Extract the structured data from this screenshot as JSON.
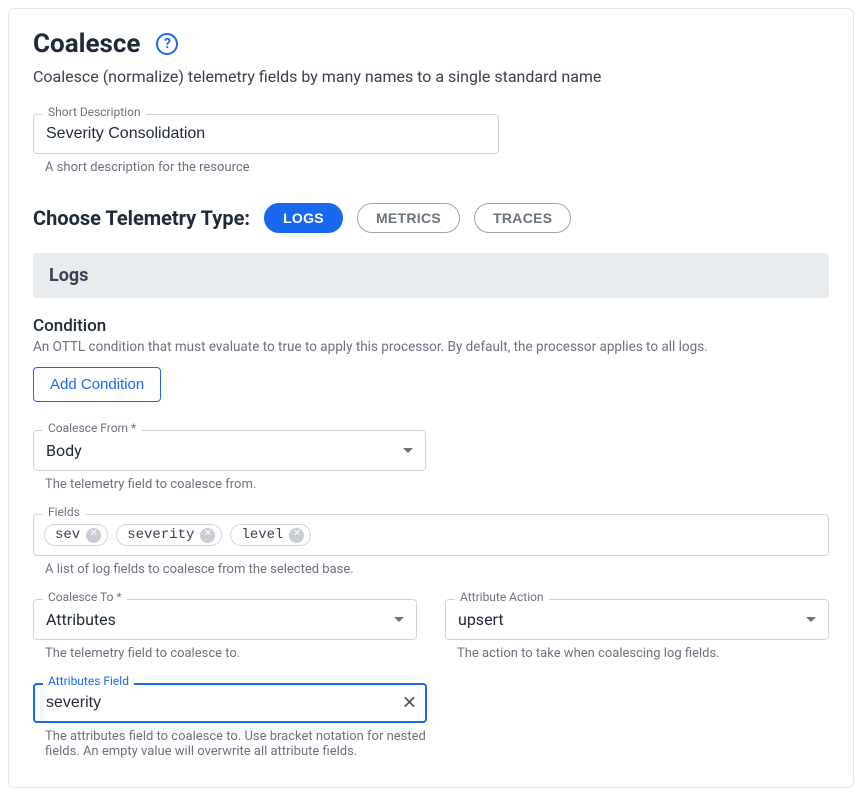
{
  "header": {
    "title": "Coalesce",
    "help_glyph": "?",
    "subtitle": "Coalesce (normalize) telemetry fields by many names to a single standard name"
  },
  "short_description": {
    "label": "Short Description",
    "value": "Severity Consolidation",
    "helper": "A short description for the resource"
  },
  "telemetry": {
    "label": "Choose Telemetry Type:",
    "options": [
      {
        "label": "LOGS",
        "active": true
      },
      {
        "label": "METRICS",
        "active": false
      },
      {
        "label": "TRACES",
        "active": false
      }
    ]
  },
  "logs": {
    "banner": "Logs",
    "condition": {
      "title": "Condition",
      "help": "An OTTL condition that must evaluate to true to apply this processor. By default, the processor applies to all logs.",
      "add_button": "Add Condition"
    },
    "coalesce_from": {
      "label": "Coalesce From *",
      "value": "Body",
      "helper": "The telemetry field to coalesce from."
    },
    "fields": {
      "label": "Fields",
      "chips": [
        "sev",
        "severity",
        "level"
      ],
      "helper": "A list of log fields to coalesce from the selected base."
    },
    "coalesce_to": {
      "label": "Coalesce To *",
      "value": "Attributes",
      "helper": "The telemetry field to coalesce to."
    },
    "attribute_action": {
      "label": "Attribute Action",
      "value": "upsert",
      "helper": "The action to take when coalescing log fields."
    },
    "attributes_field": {
      "label": "Attributes Field",
      "value": "severity",
      "helper": "The attributes field to coalesce to. Use bracket notation for nested fields. An empty value will overwrite all attribute fields."
    }
  }
}
